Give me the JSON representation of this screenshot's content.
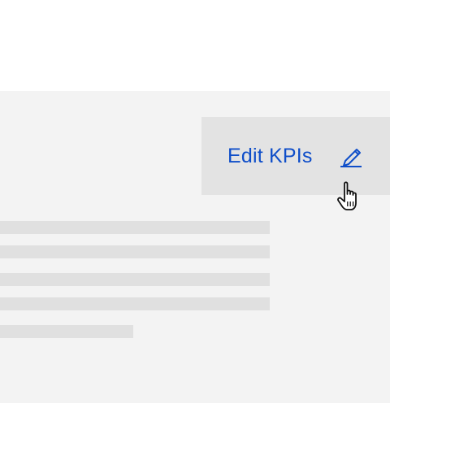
{
  "action": {
    "label": "Edit KPIs",
    "icon": "pencil-edit-icon"
  },
  "cursor": {
    "icon": "hand-pointer-icon"
  },
  "colors": {
    "accent": "#0f4ec9",
    "panel": "#f3f3f3",
    "button": "#e3e3e3",
    "skeleton": "#e0e0e0"
  }
}
